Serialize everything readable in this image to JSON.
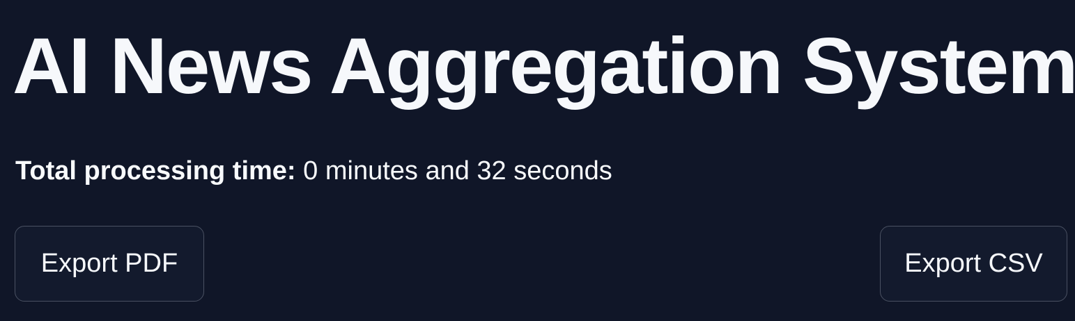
{
  "header": {
    "title": "AI News Aggregation System"
  },
  "summary": {
    "processing_label": "Total processing time:",
    "processing_value": "0 minutes and 32 seconds"
  },
  "actions": {
    "export_pdf_label": "Export PDF",
    "export_csv_label": "Export CSV"
  },
  "colors": {
    "background": "#101628",
    "text": "#f6f8fb",
    "button_background": "#131a2d",
    "button_border": "#4a5162"
  }
}
